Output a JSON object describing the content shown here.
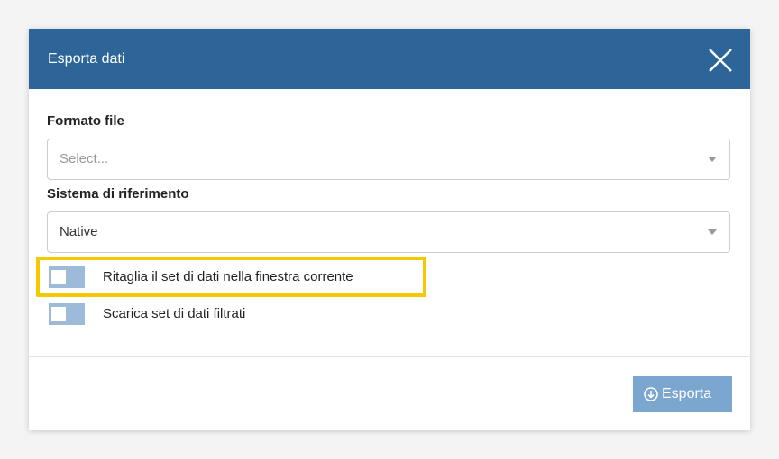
{
  "dialog": {
    "title": "Esporta dati",
    "header_color": "#2d6598"
  },
  "format": {
    "label": "Formato file",
    "placeholder": "Select..."
  },
  "reference": {
    "label": "Sistema di riferimento",
    "value": "Native"
  },
  "options": [
    {
      "label": "Ritaglia il set di dati nella finestra corrente",
      "checked": false
    },
    {
      "label": "Scarica set di dati filtrati",
      "checked": false
    }
  ],
  "footer": {
    "export_label": "Esporta",
    "export_icon": "download-circle-icon",
    "button_color": "#7aa6cf"
  },
  "highlight_color": "#f6c800"
}
